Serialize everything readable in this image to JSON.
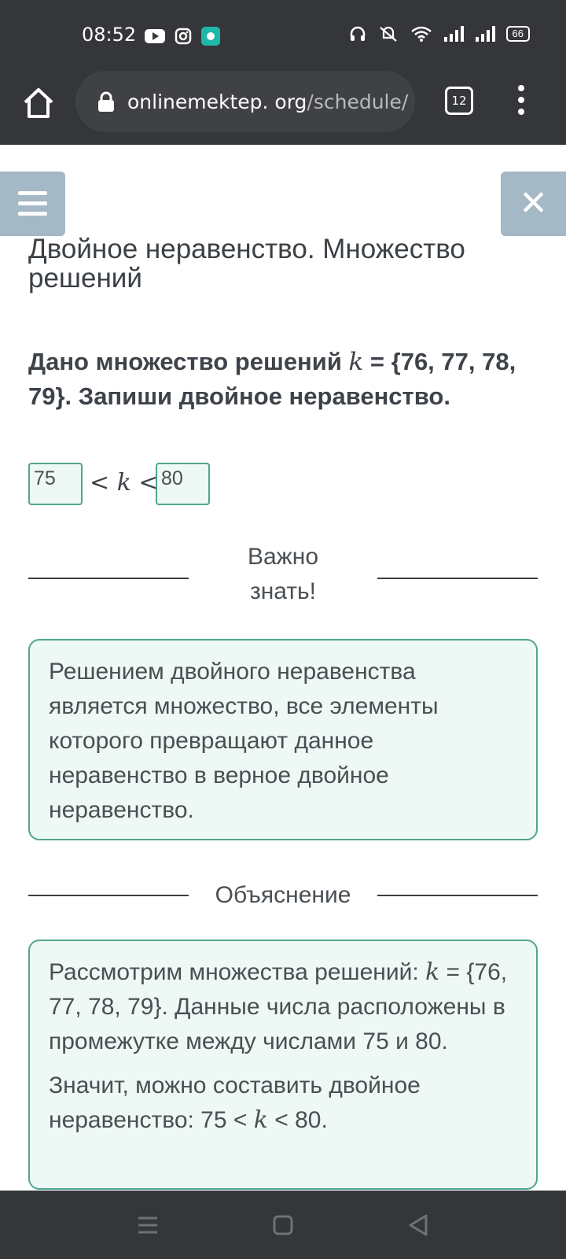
{
  "status_bar": {
    "time": "08:52",
    "left_icons": [
      "youtube-icon",
      "instagram-icon",
      "app-icon"
    ],
    "right_icons": [
      "headset-icon",
      "mute-icon",
      "wifi-icon",
      "signal-icon",
      "signal-icon"
    ],
    "battery": "66"
  },
  "browser": {
    "url_domain": "onlinemektep. org",
    "url_path": "/schedule/",
    "tab_count": "12"
  },
  "page": {
    "title": "Двойное неравенство. Множество решений",
    "question": {
      "part1": "Дано множество решений ",
      "var": "k",
      "part2": " = {76, 77, 78, 79}. Запиши двойное неравенство."
    },
    "answer": {
      "left_value": "75",
      "right_value": "80",
      "lt": "<",
      "var": "k"
    },
    "important_label": "Важно знать!",
    "important_text": "Решением двойного неравенства является множество, все элементы которого превращают данное неравенство в верное двойное неравенство.",
    "explanation_label": "Объяснение",
    "explanation": {
      "p1_part1": "Рассмотрим множества решений: ",
      "p1_var": "k",
      "p1_part2": " = {76, 77, 78, 79}. Данные числа расположены в промежутке между числами 75 и 80.",
      "p2_part1": "Значит, можно составить двойное неравенство: 75 < ",
      "p2_var": "k",
      "p2_part2": " < 80."
    }
  },
  "colors": {
    "bar_bg": "#343639",
    "accent_green": "#4fa591",
    "box_bg": "#eef8f4",
    "button_bg": "#a4b8c6"
  }
}
